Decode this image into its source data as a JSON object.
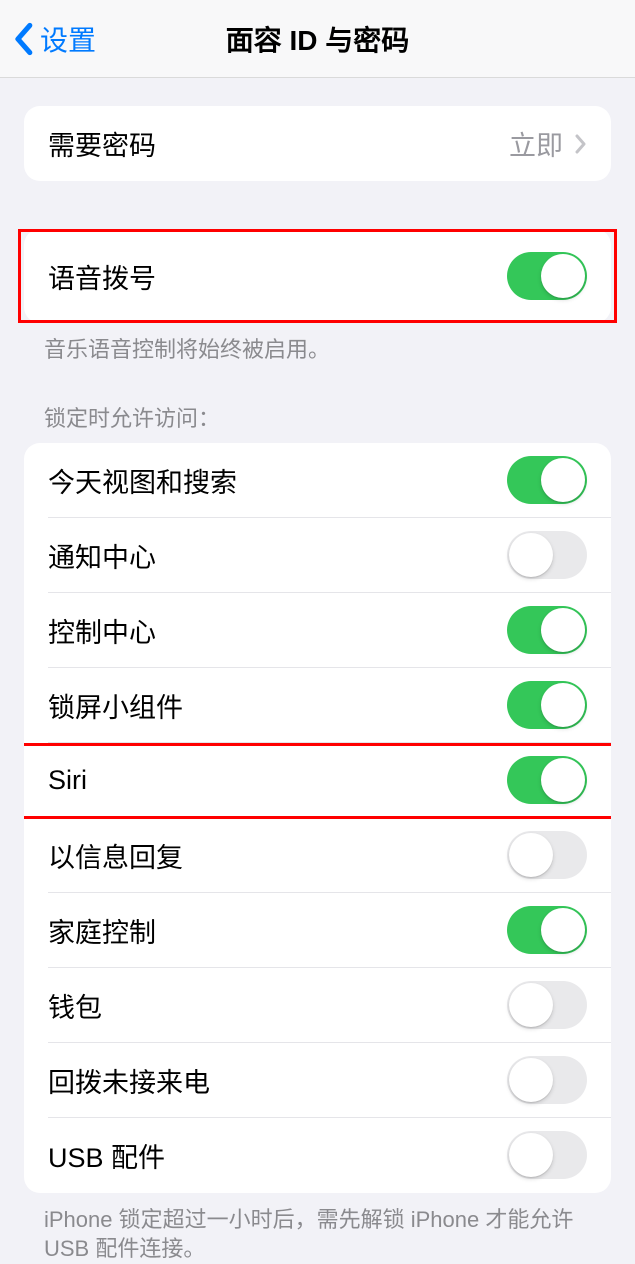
{
  "header": {
    "back_label": "设置",
    "title": "面容 ID 与密码"
  },
  "require_passcode": {
    "label": "需要密码",
    "value": "立即"
  },
  "voice_dial": {
    "label": "语音拨号",
    "on": true,
    "footer": "音乐语音控制将始终被启用。"
  },
  "lock_access": {
    "header": "锁定时允许访问：",
    "items": [
      {
        "label": "今天视图和搜索",
        "on": true
      },
      {
        "label": "通知中心",
        "on": false
      },
      {
        "label": "控制中心",
        "on": true
      },
      {
        "label": "锁屏小组件",
        "on": true
      },
      {
        "label": "Siri",
        "on": true
      },
      {
        "label": "以信息回复",
        "on": false
      },
      {
        "label": "家庭控制",
        "on": true
      },
      {
        "label": "钱包",
        "on": false
      },
      {
        "label": "回拨未接来电",
        "on": false
      },
      {
        "label": "USB 配件",
        "on": false
      }
    ],
    "footer": "iPhone 锁定超过一小时后，需先解锁 iPhone 才能允许 USB 配件连接。"
  }
}
